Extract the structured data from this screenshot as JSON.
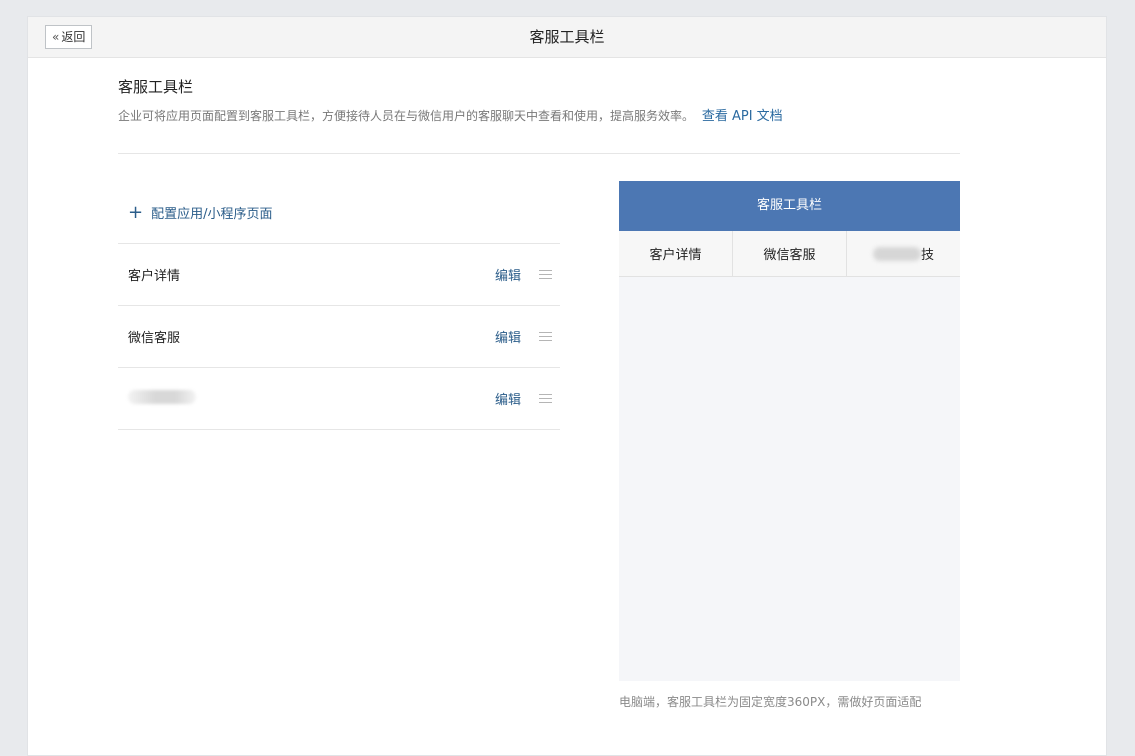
{
  "topbar": {
    "back_label": "返回",
    "back_icon": "double-chevron-left-icon",
    "title": "客服工具栏"
  },
  "intro": {
    "title": "客服工具栏",
    "description": "企业可将应用页面配置到客服工具栏，方便接待人员在与微信用户的客服聊天中查看和使用，提高服务效率。",
    "api_link": "查看 API 文档"
  },
  "config": {
    "add_label": "配置应用/小程序页面",
    "add_icon": "plus-icon",
    "edit_label": "编辑",
    "items": [
      {
        "name": "客户详情"
      },
      {
        "name": "微信客服"
      },
      {
        "name": ""
      }
    ]
  },
  "preview": {
    "header_title": "客服工具栏",
    "tabs": [
      {
        "label": "客户详情"
      },
      {
        "label": "微信客服"
      },
      {
        "label_visible_suffix": "技"
      }
    ]
  },
  "footnote": "电脑端，客服工具栏为固定宽度360PX，需做好页面适配",
  "colors": {
    "accent": "#2b5d8a",
    "preview_header": "#4c77b3",
    "background": "#e8eaed"
  }
}
